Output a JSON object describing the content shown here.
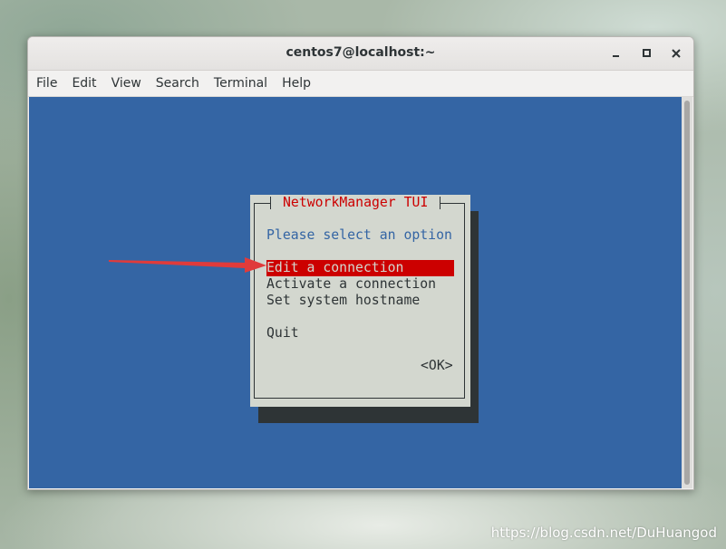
{
  "window": {
    "title": "centos7@localhost:~",
    "controls": {
      "minimize_icon": "minimize-icon",
      "maximize_icon": "maximize-icon",
      "close_icon": "close-icon"
    }
  },
  "menubar": {
    "items": [
      {
        "label": "File"
      },
      {
        "label": "Edit"
      },
      {
        "label": "View"
      },
      {
        "label": "Search"
      },
      {
        "label": "Terminal"
      },
      {
        "label": "Help"
      }
    ]
  },
  "dialog": {
    "title": "NetworkManager TUI",
    "prompt": "Please select an option",
    "options": [
      {
        "label": "Edit a connection",
        "selected": true
      },
      {
        "label": "Activate a connection",
        "selected": false
      },
      {
        "label": "Set system hostname",
        "selected": false
      },
      {
        "label": "Quit",
        "selected": false
      }
    ],
    "ok_label": "<OK>"
  },
  "annotation": {
    "arrow_color": "#e03b3b",
    "points_to": "Edit a connection"
  },
  "watermark": "https://blog.csdn.net/DuHuangod",
  "colors": {
    "terminal_bg": "#3465a4",
    "dialog_bg": "#d3d7cf",
    "dialog_title": "#cc0000",
    "selection_bg": "#cc0000",
    "prompt_text": "#3465a4",
    "shadow": "#2e3436"
  }
}
